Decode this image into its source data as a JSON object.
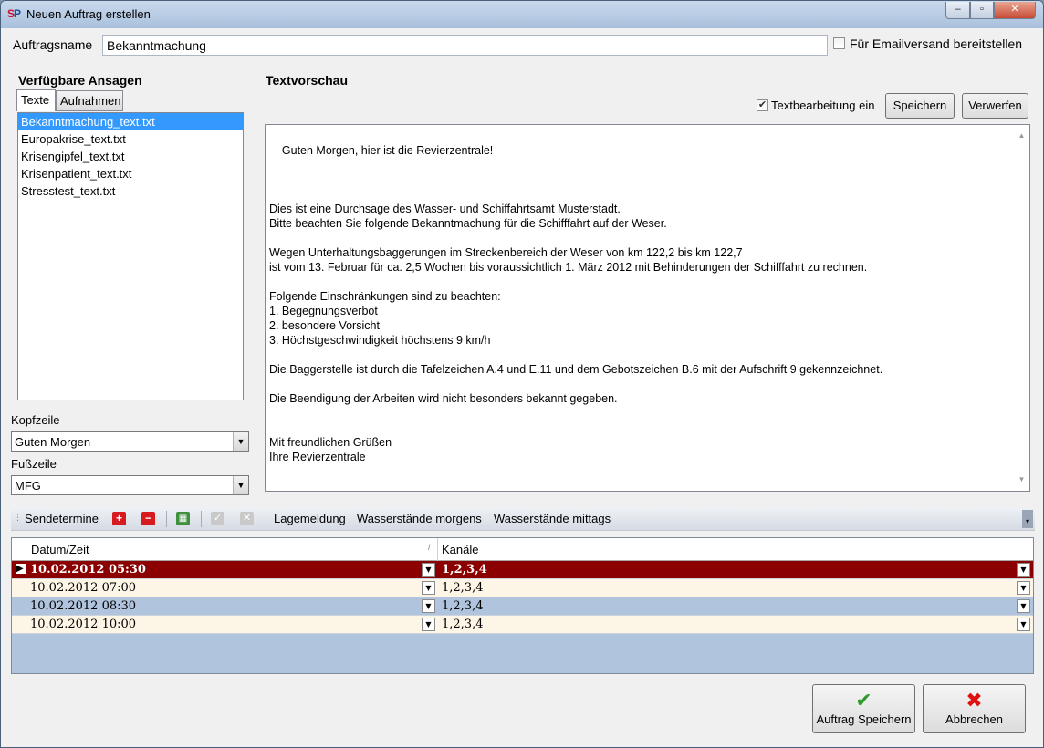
{
  "window": {
    "title": "Neuen Auftrag erstellen",
    "app_icon": {
      "part1": "S",
      "part2": "P"
    },
    "controls": {
      "minimize": "‒",
      "maximize": "▫",
      "close": "✕"
    }
  },
  "job": {
    "name_label": "Auftragsname",
    "name_value": "Bekanntmachung",
    "email_label": "Für Emailversand bereitstellen"
  },
  "ansagen": {
    "title": "Verfügbare Ansagen",
    "tabs": [
      "Texte",
      "Aufnahmen"
    ],
    "items": [
      "Bekanntmachung_text.txt",
      "Europakrise_text.txt",
      "Krisengipfel_text.txt",
      "Krisenpatient_text.txt",
      "Stresstest_text.txt"
    ]
  },
  "kopfzeile": {
    "label": "Kopfzeile",
    "value": "Guten Morgen"
  },
  "fusszeile": {
    "label": "Fußzeile",
    "value": "MFG"
  },
  "preview": {
    "title": "Textvorschau",
    "edit_label": "Textbearbeitung ein",
    "save_label": "Speichern",
    "discard_label": "Verwerfen",
    "text": "Guten Morgen, hier ist die Revierzentrale!\n\n\n\nDies ist eine Durchsage des Wasser- und Schiffahrtsamt Musterstadt.\nBitte beachten Sie folgende Bekanntmachung für die Schifffahrt auf der Weser.\n\nWegen Unterhaltungsbaggerungen im Streckenbereich der Weser von km 122,2 bis km 122,7\nist vom 13. Februar für ca. 2,5 Wochen bis voraussichtlich 1. März 2012 mit Behinderungen der Schifffahrt zu rechnen.\n\nFolgende Einschränkungen sind zu beachten:\n1. Begegnungsverbot\n2. besondere Vorsicht\n3. Höchstgeschwindigkeit höchstens 9 km/h\n\nDie Baggerstelle ist durch die Tafelzeichen A.4 und E.11 und dem Gebotszeichen B.6 mit der Aufschrift 9 gekennzeichnet.\n\nDie Beendigung der Arbeiten wird nicht besonders bekannt gegeben.\n\n\nMit freundlichen Grüßen\nIhre Revierzentrale"
  },
  "toolbar": {
    "title": "Sendetermine",
    "presets": [
      "Lagemeldung",
      "Wasserstände morgens",
      "Wasserstände mittags"
    ]
  },
  "schedule": {
    "columns": [
      "Datum/Zeit",
      "Kanäle"
    ],
    "rows": [
      {
        "datetime": "10.02.2012 05:30",
        "channels": "1,2,3,4"
      },
      {
        "datetime": "10.02.2012 07:00",
        "channels": "1,2,3,4"
      },
      {
        "datetime": "10.02.2012 08:30",
        "channels": "1,2,3,4"
      },
      {
        "datetime": "10.02.2012 10:00",
        "channels": "1,2,3,4"
      }
    ]
  },
  "actions": {
    "save": "Auftrag Speichern",
    "cancel": "Abbrechen"
  },
  "colors": {
    "selected_row": "#8b0000",
    "row_light": "#fdf5e6",
    "row_blue": "#b0c4de",
    "list_selection": "#3399ff"
  }
}
